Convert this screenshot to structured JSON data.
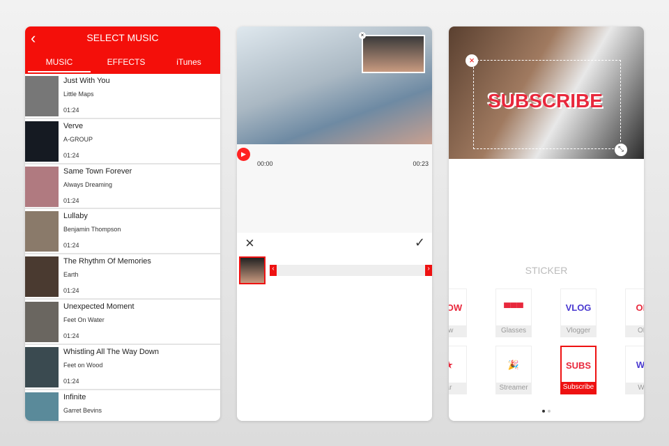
{
  "music": {
    "title": "SELECT MUSIC",
    "tabs": [
      "MUSIC",
      "EFFECTS",
      "iTunes"
    ],
    "tracks": [
      {
        "title": "Just With You",
        "artist": "Little Maps",
        "duration": "01:24",
        "color": "#777"
      },
      {
        "title": "Verve",
        "artist": "A-GROUP",
        "duration": "01:24",
        "color": "#151a22"
      },
      {
        "title": "Same Town Forever",
        "artist": "Always Dreaming",
        "duration": "01:24",
        "color": "#b07a80"
      },
      {
        "title": "Lullaby",
        "artist": "Benjamin Thompson",
        "duration": "01:24",
        "color": "#8a7a6a"
      },
      {
        "title": "The Rhythm Of Memories",
        "artist": "Earth",
        "duration": "01:24",
        "color": "#4a3a30"
      },
      {
        "title": "Unexpected Moment",
        "artist": "Feet On Water",
        "duration": "01:24",
        "color": "#6a6660"
      },
      {
        "title": "Whistling All The Way Down",
        "artist": "Feet on Wood",
        "duration": "01:24",
        "color": "#3a4a50"
      },
      {
        "title": "Infinite",
        "artist": "Garret Bevins",
        "duration": "",
        "color": "#5a8a9a"
      }
    ]
  },
  "editor": {
    "time_start": "00:00",
    "time_end": "00:23"
  },
  "sticker": {
    "title": "STICKER",
    "overlay_text": "SUBSCRIBE",
    "items": [
      {
        "label": "ow",
        "art": "LLOW"
      },
      {
        "label": "Glasses",
        "art": "▀▀▀"
      },
      {
        "label": "Vlogger",
        "art": "VLOG"
      },
      {
        "label": "OM",
        "art": "OM"
      },
      {
        "label": "ar",
        "art": "★"
      },
      {
        "label": "Streamer",
        "art": "🎉"
      },
      {
        "label": "Subscribe",
        "art": "SUBS",
        "selected": true
      },
      {
        "label": "WT",
        "art": "WT"
      }
    ]
  },
  "accent": "#f40f0a"
}
